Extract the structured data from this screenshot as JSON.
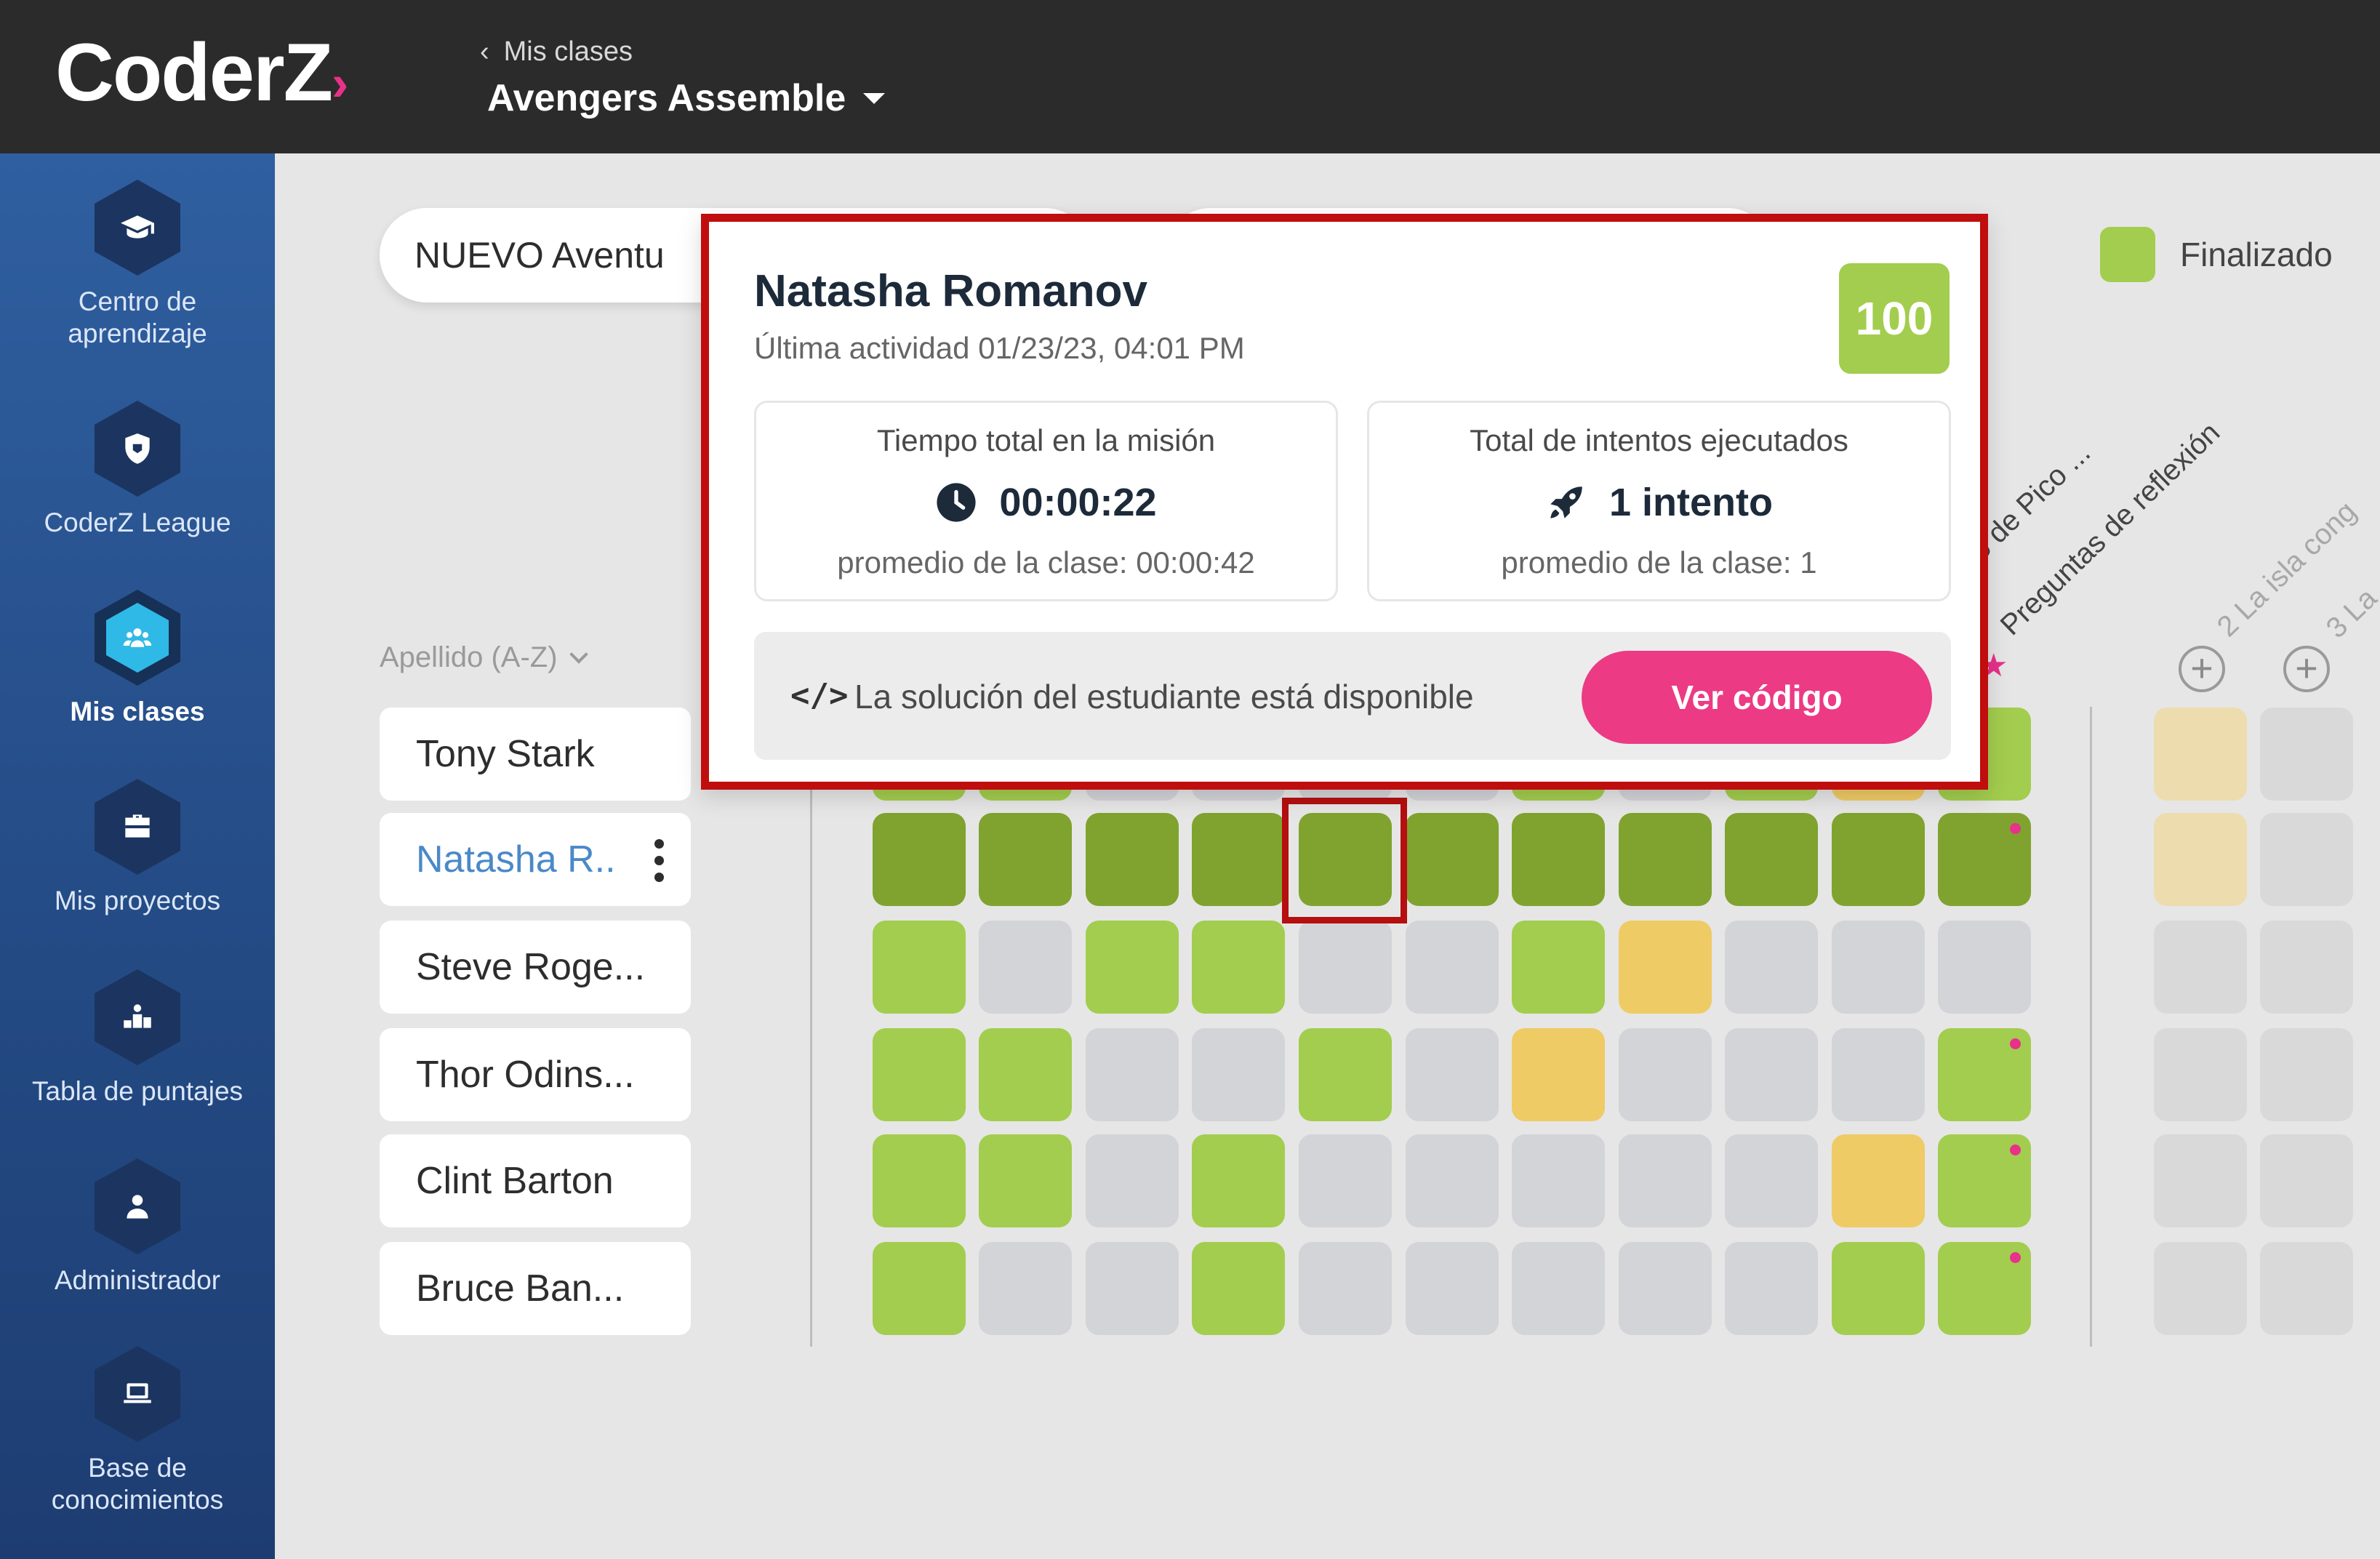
{
  "app": {
    "logo": "CoderZ",
    "breadcrumb": "Mis clases",
    "class_name": "Avengers Assemble"
  },
  "sidebar": {
    "items": [
      {
        "label": "Centro de aprendizaje",
        "icon": "graduation-cap-icon"
      },
      {
        "label": "CoderZ League",
        "icon": "shield-icon"
      },
      {
        "label": "Mis clases",
        "icon": "group-icon",
        "active": true
      },
      {
        "label": "Mis proyectos",
        "icon": "briefcase-icon"
      },
      {
        "label": "Tabla de puntajes",
        "icon": "podium-icon"
      },
      {
        "label": "Administrador",
        "icon": "user-icon"
      },
      {
        "label": "Base de conocimientos",
        "icon": "laptop-icon"
      }
    ]
  },
  "filters": {
    "course": "NUEVO Aventu"
  },
  "legend": {
    "finished": "Finalizado",
    "finished_color": "#a3cd4e"
  },
  "columns": {
    "partial_1": "rio de Pico ...",
    "reflection": "Preguntas de reflexión",
    "faded_1": "2 La isla cong",
    "faded_2": "3 La"
  },
  "sort_label": "Apellido (A-Z)",
  "students": [
    {
      "name": "Tony Stark"
    },
    {
      "name": "Natasha R..",
      "selected": true
    },
    {
      "name": "Steve Roge..."
    },
    {
      "name": "Thor Odins..."
    },
    {
      "name": "Clint Barton"
    },
    {
      "name": "Bruce Ban..."
    }
  ],
  "grid_colors": {
    "dark_green": "#7fa32e",
    "light_green": "#a3cd4e",
    "gray": "#d3d4d8",
    "yellow": "#efcb66"
  },
  "popup": {
    "student_name": "Natasha Romanov",
    "last_activity": "Última actividad 01/23/23, 04:01 PM",
    "score": "100",
    "time_title": "Tiempo total en la misión",
    "time_value": "00:00:22",
    "time_avg": "promedio de la clase:  00:00:42",
    "attempts_title": "Total de intentos ejecutados",
    "attempts_value": "1 intento",
    "attempts_avg": "promedio de la clase: 1",
    "solution_msg": "La solución del estudiante está disponible",
    "code_icon": "</>",
    "view_code": "Ver código"
  }
}
